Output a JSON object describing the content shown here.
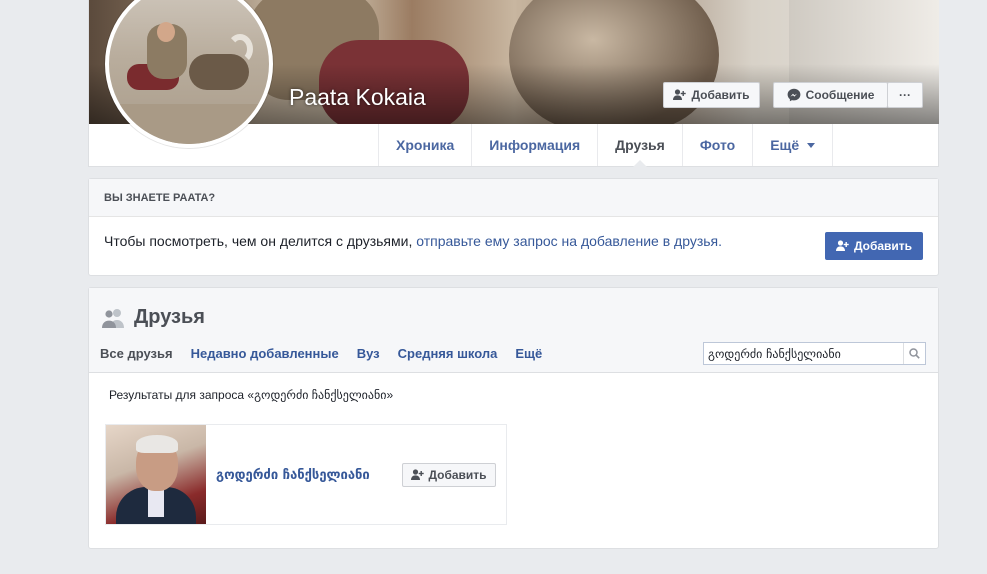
{
  "profile": {
    "name": "Paata Kokaia",
    "add_label": "Добавить",
    "message_label": "Сообщение",
    "more_label": "···"
  },
  "tabs": [
    {
      "label": "Хроника"
    },
    {
      "label": "Информация"
    },
    {
      "label": "Друзья"
    },
    {
      "label": "Фото"
    },
    {
      "label": "Ещё"
    }
  ],
  "know": {
    "header": "ВЫ ЗНАЕТЕ PAATA?",
    "text": "Чтобы посмотреть, чем он делится с друзьями, ",
    "link": "отправьте ему запрос на добавление в друзья.",
    "add_label": "Добавить"
  },
  "friends": {
    "title": "Друзья",
    "tabs": [
      {
        "label": "Все друзья"
      },
      {
        "label": "Недавно добавленные"
      },
      {
        "label": "Вуз"
      },
      {
        "label": "Средняя школа"
      },
      {
        "label": "Ещё"
      }
    ],
    "search_value": "გოდერძი ჩანქსელიანი",
    "results_text": "Результаты для запроса «გოდერძი ჩანქსელიანი»",
    "card": {
      "name": "გოდერძი ჩანქსელიანი",
      "add_label": "Добавить"
    }
  },
  "colors": {
    "brand": "#4267b2",
    "link": "#365899"
  }
}
